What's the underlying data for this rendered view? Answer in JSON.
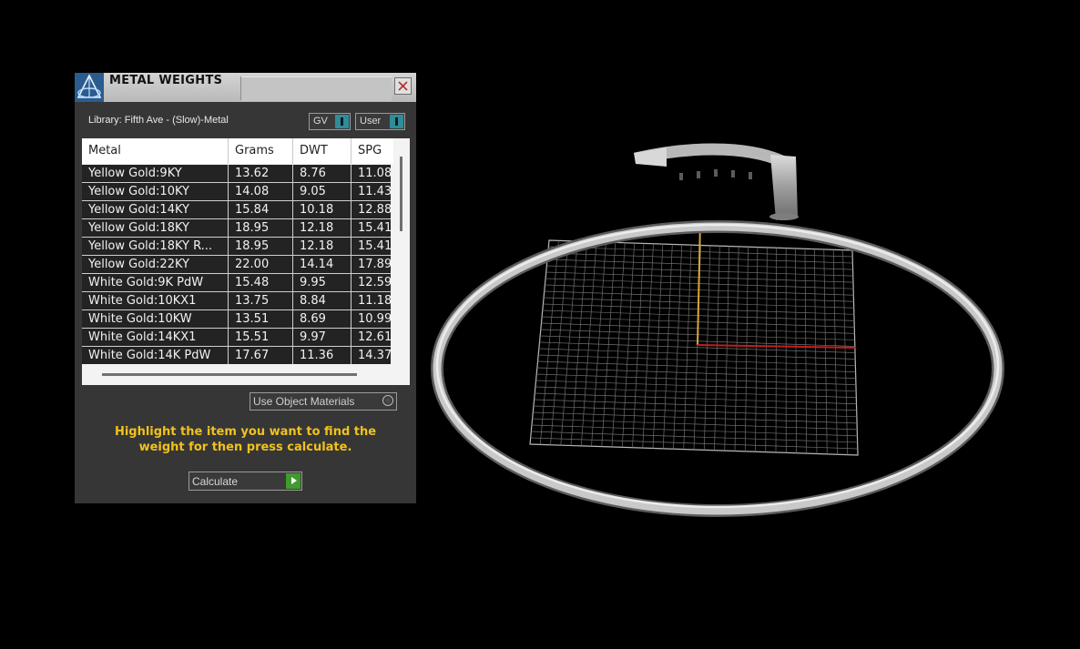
{
  "window": {
    "title": "METAL WEIGHTS",
    "close_icon": "close-icon",
    "logo_icon": "app-logo-icon"
  },
  "library": {
    "label": "Library: Fifth Ave - (Slow)-Metal",
    "toggle_gv": "GV",
    "toggle_user": "User"
  },
  "table": {
    "columns": [
      "Metal",
      "Grams",
      "DWT",
      "SPG"
    ],
    "rows": [
      [
        "Yellow Gold:9KY",
        "13.62",
        "8.76",
        "11.08"
      ],
      [
        "Yellow Gold:10KY",
        "14.08",
        "9.05",
        "11.43"
      ],
      [
        "Yellow Gold:14KY",
        "15.84",
        "10.18",
        "12.88"
      ],
      [
        "Yellow Gold:18KY",
        "18.95",
        "12.18",
        "15.41"
      ],
      [
        "Yellow Gold:18KY R...",
        "18.95",
        "12.18",
        "15.41"
      ],
      [
        "Yellow Gold:22KY",
        "22.00",
        "14.14",
        "17.89"
      ],
      [
        "White Gold:9K PdW",
        "15.48",
        "9.95",
        "12.59"
      ],
      [
        "White Gold:10KX1",
        "13.75",
        "8.84",
        "11.18"
      ],
      [
        "White Gold:10KW",
        "13.51",
        "8.69",
        "10.99"
      ],
      [
        "White Gold:14KX1",
        "15.51",
        "9.97",
        "12.61"
      ],
      [
        "White Gold:14K PdW",
        "17.67",
        "11.36",
        "14.37"
      ]
    ]
  },
  "options": {
    "use_object_materials": "Use Object Materials"
  },
  "hint": "Highlight the item you want to find the weight for then press calculate.",
  "actions": {
    "calculate": "Calculate"
  },
  "colors": {
    "panel_bg": "#363636",
    "hint_text": "#f1c21b",
    "toggle_accent": "#2f8c99",
    "play_accent": "#3f9a2f",
    "axis_y": "#d9a63a",
    "axis_x": "#c0201e"
  }
}
